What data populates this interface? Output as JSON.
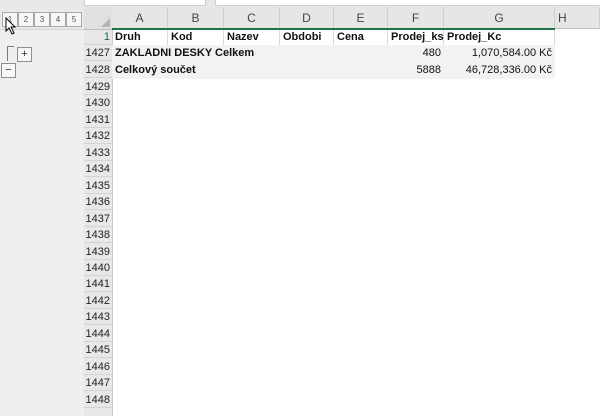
{
  "outline": {
    "levels": [
      "1",
      "2",
      "3",
      "4",
      "5"
    ],
    "expand_symbol": "+",
    "collapse_symbol": "−"
  },
  "grid": {
    "columns": [
      "A",
      "B",
      "C",
      "D",
      "E",
      "F",
      "G",
      "H"
    ],
    "header_row_number": "1",
    "header_values": [
      "Druh",
      "Kod",
      "Nazev",
      "Obdobi",
      "Cena",
      "Prodej_ks",
      "Prodej_Kc"
    ],
    "rows": [
      {
        "number": "1427",
        "a": "ZAKLADNI DESKY Celkem",
        "f": "480",
        "g": "1,070,584.00 Kč"
      },
      {
        "number": "1428",
        "a": "Celkový součet",
        "f": "5888",
        "g": "46,728,336.00 Kč"
      }
    ],
    "empty_row_numbers": [
      "1429",
      "1430",
      "1431",
      "1432",
      "1433",
      "1434",
      "1435",
      "1436",
      "1437",
      "1438",
      "1439",
      "1440",
      "1441",
      "1442",
      "1443",
      "1444",
      "1445",
      "1446",
      "1447",
      "1448"
    ]
  }
}
